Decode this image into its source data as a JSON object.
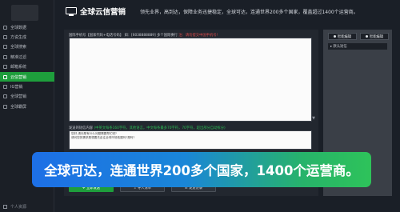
{
  "sidebar": {
    "items": [
      {
        "label": "全球数据",
        "active": false
      },
      {
        "label": "方说生成",
        "active": false
      },
      {
        "label": "全球搜索",
        "active": false
      },
      {
        "label": "精准过滤",
        "active": false
      },
      {
        "label": "邮箱系统",
        "active": false
      },
      {
        "label": "云信营销",
        "active": true
      },
      {
        "label": "IG营销",
        "active": false
      },
      {
        "label": "全球营销",
        "active": false
      },
      {
        "label": "全球霸屏",
        "active": false
      }
    ],
    "bottom_label": "个人资源"
  },
  "header": {
    "title": "全球云信营销",
    "tagline": "领先业界，高到达，保障业务迅捷稳定，全球可达，连通世界200多个国家，覆盖超过1400个运营商。"
  },
  "main": {
    "phone_label_prefix": "国际手机号【国家代码+电话号码】",
    "phone_label_example": "如：[6038888889]",
    "phone_label_extra": "多个国际换行",
    "phone_label_hint": "注：请勿提交中国手机号!",
    "message_label_prefix": "发送的短信内容",
    "message_label_hint": "(中英文每条160字符，其他语言，中文每条最多70字符，70字符，超出部分自动拆分)",
    "message_line1": "您好,请问是有什么问题需要帮忙呢?",
    "message_line2": "请问您的需求是想要先走往全球市场拓展吗?是吗?"
  },
  "right_panel": {
    "btn1": "智能编辑",
    "btn2": "智能编辑",
    "list_header": "默认短信"
  },
  "bottom": {
    "send_button": "立即发送",
    "import_button": "导入清单",
    "record_button": "发送记录"
  },
  "banner": {
    "text": "全球可达，连通世界200多个国家，1400个运营商。"
  },
  "colors": {
    "accent_green": "#1e9e3c",
    "banner_blue": "#1d6fe6",
    "banner_green": "#2ec35a"
  }
}
